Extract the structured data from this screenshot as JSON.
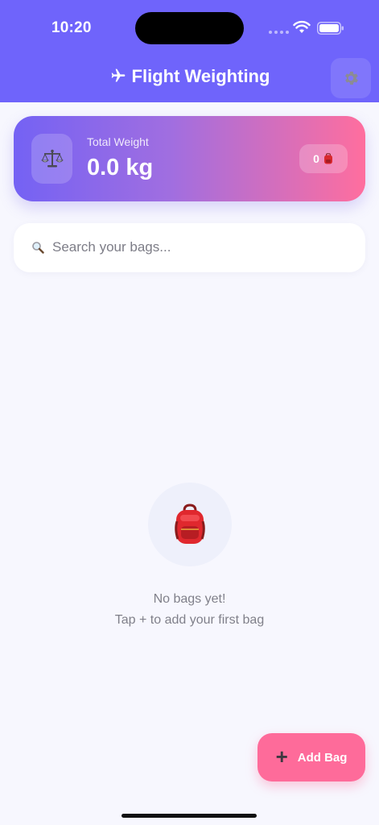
{
  "status_bar": {
    "time": "10:20"
  },
  "header": {
    "title": "Flight Weighting",
    "title_icon": "airplane-icon",
    "settings_icon": "gear-icon",
    "color": "#6f64fb"
  },
  "summary_card": {
    "label": "Total Weight",
    "value": "0.0 kg",
    "bag_count": "0",
    "scale_icon": "balance-scale-icon",
    "badge_icon": "backpack-icon"
  },
  "search": {
    "placeholder": "Search your bags...",
    "value": ""
  },
  "empty_state": {
    "icon": "backpack-icon",
    "title": "No bags yet!",
    "subtitle": "Tap + to add your first bag"
  },
  "fab": {
    "icon": "plus-icon",
    "label": "Add Bag",
    "color": "#fe6b9a"
  }
}
